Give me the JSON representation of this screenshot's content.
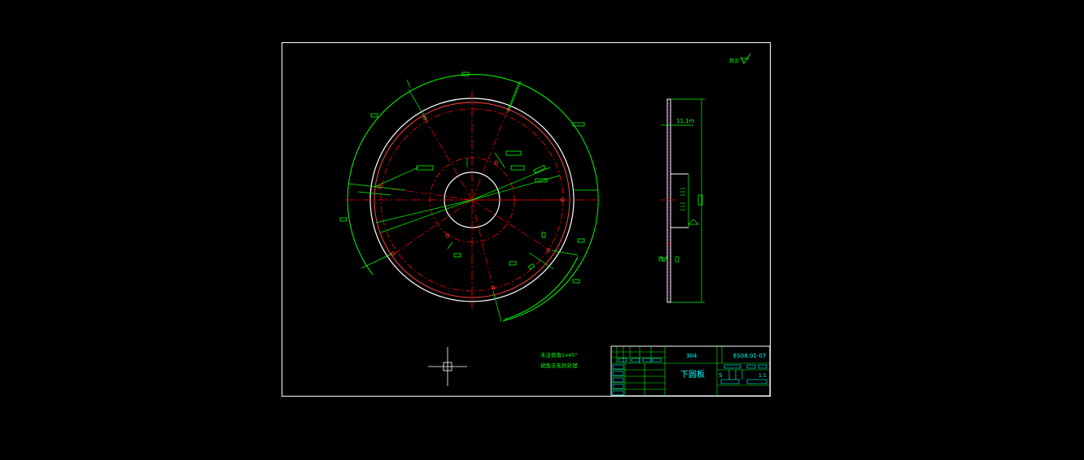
{
  "colors": {
    "background": "#000000",
    "border": "#ffffff",
    "dimension": "#00ff00",
    "center_line": "#ff0000",
    "outline": "#ffffff",
    "title_block": "#00ff00",
    "label": "#00ffff",
    "hatch": "#ff00ff"
  },
  "title_block": {
    "material": "304",
    "part_name": "下圆板",
    "drawing_number": "ES08.01-07",
    "scale": "1:1",
    "sheet_mark": "S"
  },
  "notes": {
    "line1": "未注倒角1x45°",
    "line2": "锐角去毛刺处理"
  },
  "side_view": {
    "dim_label": "11.1m"
  },
  "surface_symbol": {
    "label": "其余"
  },
  "icons": {
    "roughness": "surface-roughness-icon",
    "ucs": "ucs-crosshair-icon"
  }
}
